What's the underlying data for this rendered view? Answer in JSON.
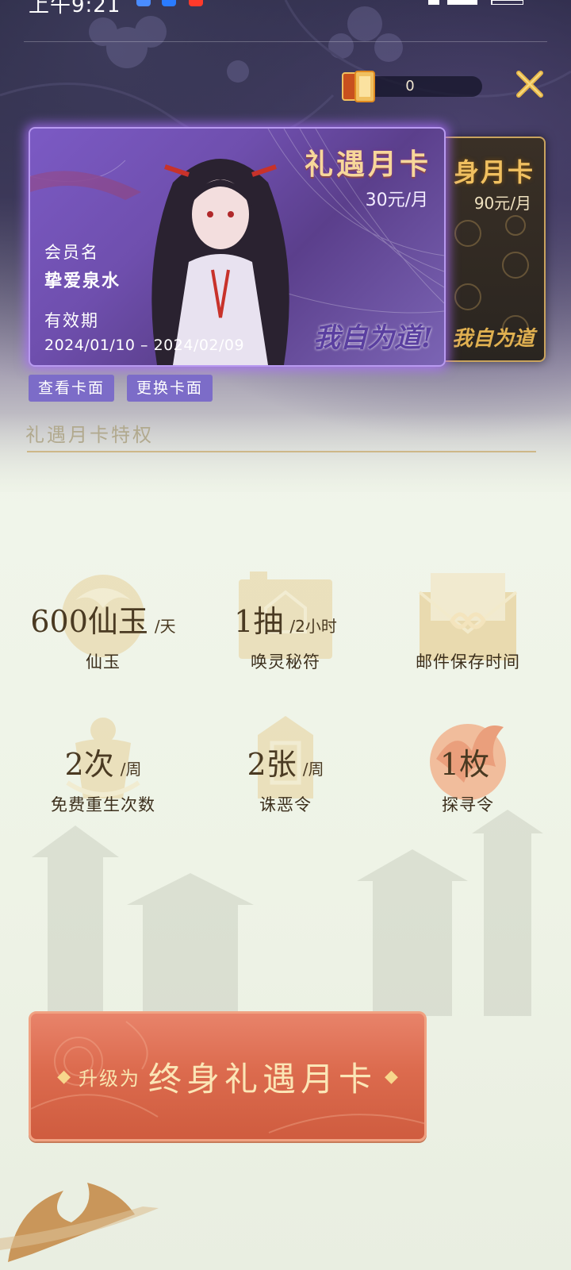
{
  "status_bar": {
    "time": "上午9:21"
  },
  "currency": {
    "value": "0"
  },
  "cards": {
    "main": {
      "title": "礼遇月卡",
      "price": "30元/月",
      "member_label": "会员名",
      "member_name": "挚爱泉水",
      "validity_label": "有效期",
      "validity": "2024/01/10 – 2024/02/09",
      "logo": "我自为道!"
    },
    "secondary": {
      "title": "身月卡",
      "price": "90元/月",
      "logo": "我自为道"
    }
  },
  "buttons": {
    "view_card": "查看卡面",
    "change_card": "更换卡面"
  },
  "section": {
    "title": "礼遇月卡特权"
  },
  "privileges": [
    {
      "value": "600仙玉",
      "unit": "/天",
      "label": "仙玉"
    },
    {
      "value": "1抽",
      "unit": "/2小时",
      "label": "唤灵秘符"
    },
    {
      "value": "",
      "unit": "",
      "label": "邮件保存时间"
    },
    {
      "value": "2次",
      "unit": "/周",
      "label": "免费重生次数"
    },
    {
      "value": "2张",
      "unit": "/周",
      "label": "诛恶令"
    },
    {
      "value": "1枚",
      "unit": "",
      "label": "探寻令"
    }
  ],
  "upgrade": {
    "prefix": "升级为",
    "main": "终身礼遇月卡",
    "diamond": "◆"
  },
  "colors": {
    "accent_purple": "#7c6cc8",
    "card_glow": "#aa6eff",
    "upgrade_red": "#dc6b4e",
    "gold": "#f0c060"
  }
}
